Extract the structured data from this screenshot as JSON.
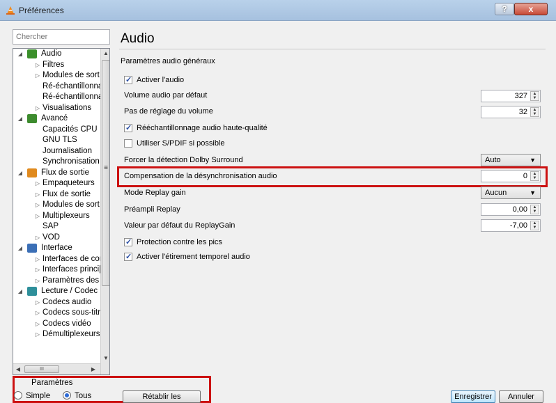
{
  "window": {
    "title": "Préférences",
    "help_label": "?",
    "close_label": "x"
  },
  "search": {
    "placeholder": "Chercher"
  },
  "tree": [
    {
      "label": "Audio",
      "level": 0,
      "arrow": "◢",
      "icon": "audio-icon",
      "icon_color": "#3a8f2a"
    },
    {
      "label": "Filtres",
      "level": 1,
      "arrow": "▷"
    },
    {
      "label": "Modules de sort",
      "level": 1,
      "arrow": "▷"
    },
    {
      "label": "Ré-échantillonna",
      "level": 1,
      "arrow": ""
    },
    {
      "label": "Ré-échantillonna",
      "level": 1,
      "arrow": ""
    },
    {
      "label": "Visualisations",
      "level": 1,
      "arrow": "▷"
    },
    {
      "label": "Avancé",
      "level": 0,
      "arrow": "◢",
      "icon": "chip-icon",
      "icon_color": "#3d8b2e"
    },
    {
      "label": "Capacités CPU",
      "level": 1,
      "arrow": ""
    },
    {
      "label": "GNU TLS",
      "level": 1,
      "arrow": ""
    },
    {
      "label": "Journalisation",
      "level": 1,
      "arrow": ""
    },
    {
      "label": "Synchronisation",
      "level": 1,
      "arrow": ""
    },
    {
      "label": "Flux de sortie",
      "level": 0,
      "arrow": "◢",
      "icon": "stream-icon",
      "icon_color": "#e08a1e"
    },
    {
      "label": "Empaqueteurs",
      "level": 1,
      "arrow": "▷"
    },
    {
      "label": "Flux de sortie",
      "level": 1,
      "arrow": "▷"
    },
    {
      "label": "Modules de sort",
      "level": 1,
      "arrow": "▷"
    },
    {
      "label": "Multiplexeurs",
      "level": 1,
      "arrow": "▷"
    },
    {
      "label": "SAP",
      "level": 1,
      "arrow": ""
    },
    {
      "label": "VOD",
      "level": 1,
      "arrow": "▷"
    },
    {
      "label": "Interface",
      "level": 0,
      "arrow": "◢",
      "icon": "interface-icon",
      "icon_color": "#3b6fb6"
    },
    {
      "label": "Interfaces de cor",
      "level": 1,
      "arrow": "▷"
    },
    {
      "label": "Interfaces princi|",
      "level": 1,
      "arrow": "▷"
    },
    {
      "label": "Paramètres des r",
      "level": 1,
      "arrow": "▷"
    },
    {
      "label": "Lecture / Codec",
      "level": 0,
      "arrow": "◢",
      "icon": "codec-icon",
      "icon_color": "#2e8f9a"
    },
    {
      "label": "Codecs audio",
      "level": 1,
      "arrow": "▷"
    },
    {
      "label": "Codecs sous-titr",
      "level": 1,
      "arrow": "▷"
    },
    {
      "label": "Codecs vidéo",
      "level": 1,
      "arrow": "▷"
    },
    {
      "label": "Démultiplexeurs",
      "level": 1,
      "arrow": "▷"
    }
  ],
  "settings_mode": {
    "title": "Paramètres",
    "simple_label": "Simple",
    "all_label": "Tous",
    "selected": "Tous"
  },
  "main": {
    "section_title": "Audio",
    "group_title": "Paramètres audio généraux",
    "enable_audio": {
      "label": "Activer l'audio",
      "checked": true
    },
    "default_volume": {
      "label": "Volume audio par défaut",
      "value": "327"
    },
    "volume_step": {
      "label": "Pas de réglage du volume",
      "value": "32"
    },
    "hq_resampling": {
      "label": "Rééchantillonnage audio haute-qualité",
      "checked": true
    },
    "spdif": {
      "label": "Utiliser S/PDIF si possible",
      "checked": false
    },
    "dolby": {
      "label": "Forcer la détection Dolby Surround",
      "value": "Auto"
    },
    "desync": {
      "label": "Compensation de la désynchronisation audio",
      "value": "0"
    },
    "replay_gain_mode": {
      "label": "Mode Replay gain",
      "value": "Aucun"
    },
    "replay_preamp": {
      "label": "Préampli Replay",
      "value": "0,00"
    },
    "replay_default": {
      "label": "Valeur par défaut du ReplayGain",
      "value": "-7,00"
    },
    "peak_protection": {
      "label": "Protection contre les pics",
      "checked": true
    },
    "time_stretch": {
      "label": "Activer l'étirement temporel audio",
      "checked": true
    }
  },
  "footer": {
    "reset_label": "Rétablir les préférences",
    "save_label": "Enregistrer",
    "cancel_label": "Annuler"
  },
  "colors": {
    "highlight": "#cc1111"
  }
}
